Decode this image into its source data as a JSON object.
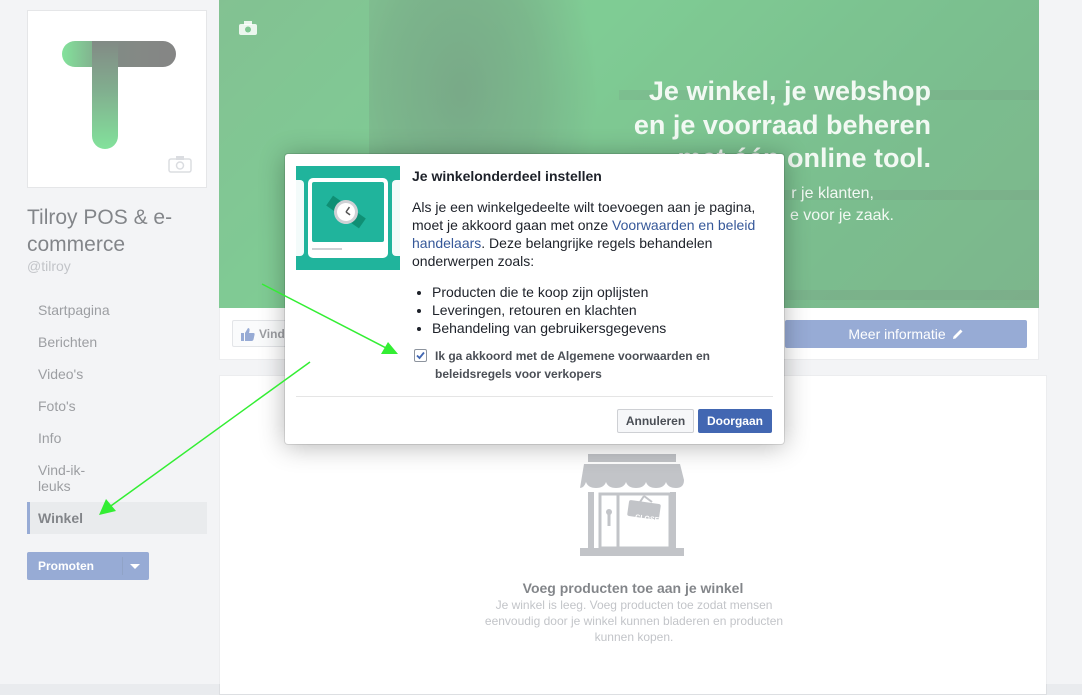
{
  "page": {
    "name": "Tilroy POS & e-commerce",
    "handle": "@tilroy"
  },
  "sidebar": {
    "items": [
      {
        "label": "Startpagina"
      },
      {
        "label": "Berichten"
      },
      {
        "label": "Video's"
      },
      {
        "label": "Foto's"
      },
      {
        "label": "Info"
      },
      {
        "label": "Vind-ik-leuks"
      },
      {
        "label": "Winkel",
        "active": true
      }
    ],
    "promote_label": "Promoten"
  },
  "cover": {
    "line1": "Je winkel, je webshop",
    "line2": "en je voorraad beheren",
    "line3": "met één online tool.",
    "line4": "r je klanten,",
    "line5": "e voor je zaak."
  },
  "actions": {
    "like_label": "Vind ik leuk",
    "more_info_label": "Meer informatie"
  },
  "shop": {
    "empty_title": "Voeg producten toe aan je winkel",
    "empty_text": "Je winkel is leeg. Voeg producten toe zodat mensen eenvoudig door je winkel kunnen bladeren en producten kunnen kopen.",
    "store_sign": "CLOSED"
  },
  "dialog": {
    "title": "Je winkelonderdeel instellen",
    "body_before": "Als je een winkelgedeelte wilt toevoegen aan je pagina, moet je akkoord gaan met onze ",
    "body_link": "Voorwaarden en beleid handelaars",
    "body_after": ". Deze belangrijke regels behandelen onderwerpen zoals:",
    "bullets": [
      "Producten die te koop zijn oplijsten",
      "Leveringen, retouren en klachten",
      "Behandeling van gebruikersgegevens"
    ],
    "consent_label": "Ik ga akkoord met de Algemene voorwaarden en beleidsregels voor verkopers",
    "consent_checked": true,
    "cancel_label": "Annuleren",
    "continue_label": "Doorgaan"
  },
  "colors": {
    "brand_blue": "#4267b2",
    "brand_green": "#17a33d",
    "annotation_arrow": "#33ee33"
  }
}
